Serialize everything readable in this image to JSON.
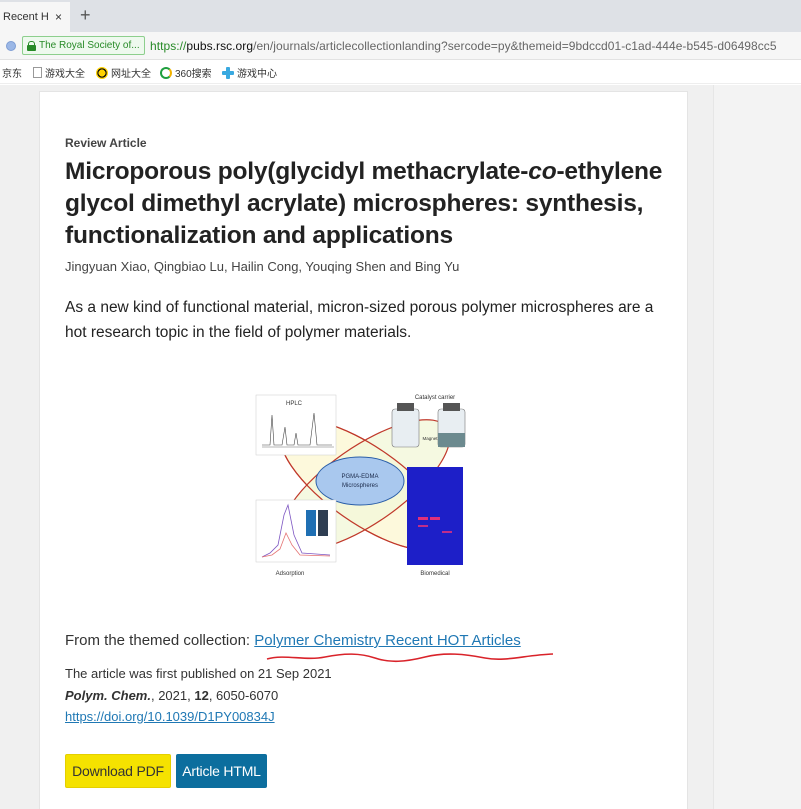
{
  "browser": {
    "tab_title": "Recent HOT",
    "tab_close": "×",
    "new_tab": "+",
    "site_badge": "The Royal Society of...",
    "url_scheme": "https://",
    "url_host": "pubs.rsc.org",
    "url_path": "/en/journals/articlecollectionlanding?sercode=py&themeid=9bdccd01-c1ad-444e-b545-d06498cc5",
    "bookmarks": [
      {
        "label": "京东",
        "icon": "none"
      },
      {
        "label": "游戏大全",
        "icon": "page-icon"
      },
      {
        "label": "网址大全",
        "icon": "nav-icon"
      },
      {
        "label": "360搜索",
        "icon": "search-360-icon"
      },
      {
        "label": "游戏中心",
        "icon": "game-center-icon"
      }
    ]
  },
  "article": {
    "type": "Review Article",
    "title_part1": "Microporous poly(glycidyl methacrylate-",
    "title_italic": "co",
    "title_part2": "-ethylene glycol dimethyl acrylate) microspheres: synthesis, functionalization and applications",
    "authors": "Jingyuan Xiao, Qingbiao Lu, Hailin Cong, Youqing Shen and Bing Yu",
    "abstract": "As a new kind of functional material, micron-sized porous polymer microspheres are a hot research topic in the field of polymer materials.",
    "graphic": {
      "center_label_1": "PGMA-EDMA",
      "center_label_2": "Microspheres",
      "top_left": "HPLC",
      "top_right": "Catalyst carrier",
      "bottom_left": "Adsorption",
      "bottom_right": "Biomedical",
      "magnet": "Magnet"
    },
    "collection_prefix": "From the themed collection: ",
    "collection_link": "Polymer Chemistry Recent HOT Articles",
    "published": "The article was first published on 21 Sep 2021",
    "journal": "Polym. Chem.",
    "citation_year": ", 2021, ",
    "volume": "12",
    "pages": ", 6050-6070",
    "doi": "https://doi.org/10.1039/D1PY00834J",
    "btn_pdf": "Download PDF",
    "btn_html": "Article HTML"
  },
  "colors": {
    "link": "#1f78b4",
    "pdf_button": "#f5e200",
    "html_button": "#0c6e9e",
    "scribble": "#d9232a"
  }
}
